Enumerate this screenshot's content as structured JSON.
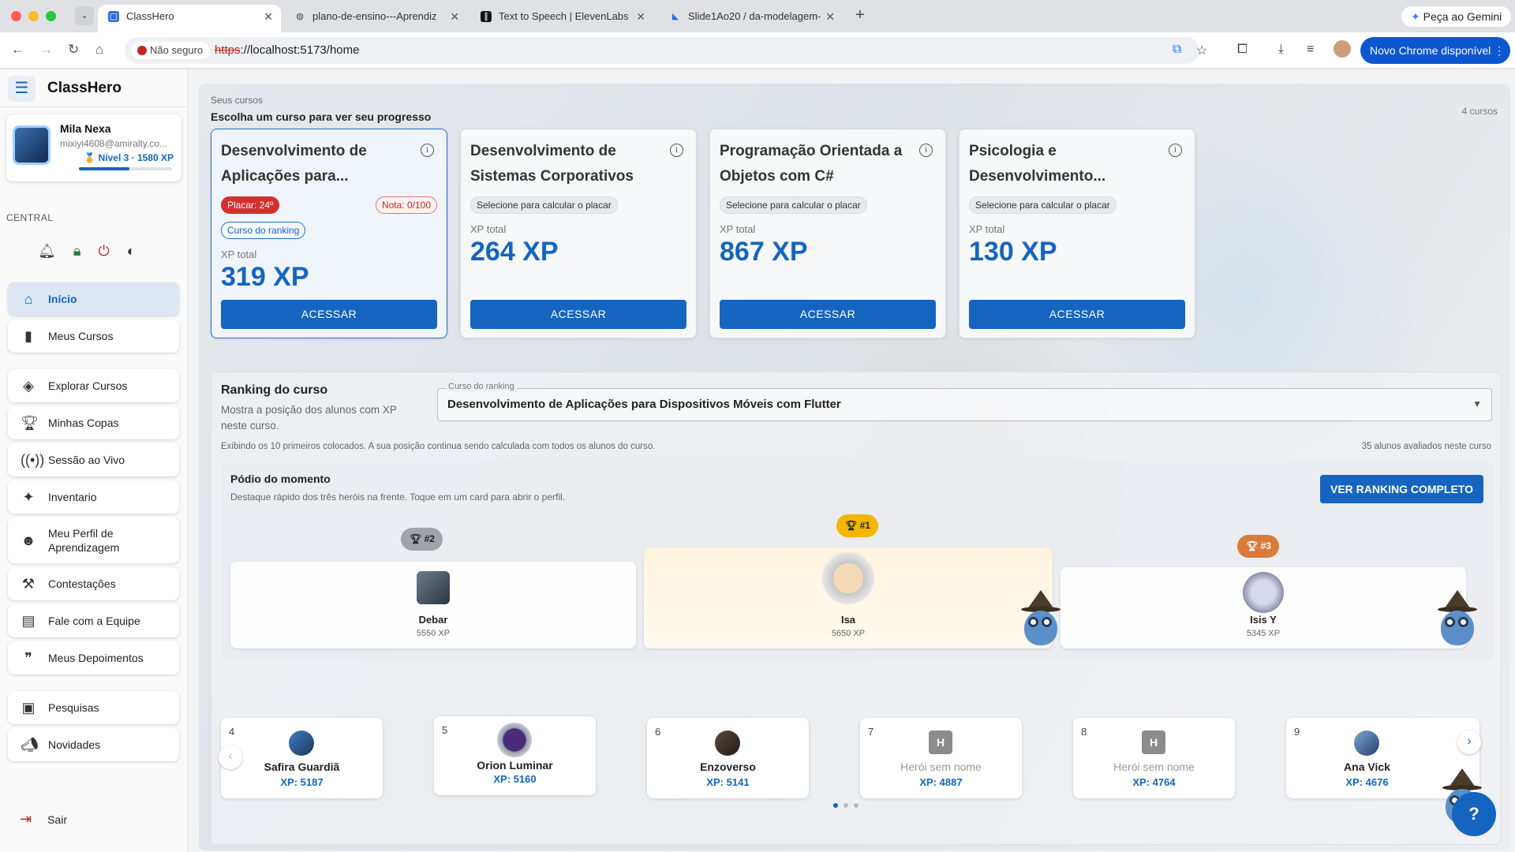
{
  "browser": {
    "tabs": [
      {
        "title": "ClassHero",
        "icon": "classhero-icon"
      },
      {
        "title": "plano-de-ensino---Aprendiz",
        "icon": "globe-icon"
      },
      {
        "title": "Text to Speech | ElevenLabs",
        "icon": "elevenlabs-icon"
      },
      {
        "title": "Slide1Ao20 / da-modelagem-",
        "icon": "bookmark-icon"
      }
    ],
    "gemini_label": "Peça ao Gemini",
    "insecure_label": "Não seguro",
    "url_scheme": "https",
    "url_rest": "://localhost:5173/home",
    "update_label": "Novo Chrome disponível"
  },
  "app": {
    "brand": "ClassHero",
    "user": {
      "name": "Mila Nexa",
      "email": "mixiyi4608@amiralty.co...",
      "level": "Nível 3 · 1580 XP",
      "level_progress": 0.54
    },
    "section_label": "CENTRAL",
    "menu": [
      {
        "label": "Início",
        "icon": "home-icon",
        "active": true
      },
      {
        "label": "Meus Cursos",
        "icon": "book-icon"
      },
      {
        "label": "Explorar Cursos",
        "icon": "school-icon"
      },
      {
        "label": "Minhas Copas",
        "icon": "trophy-icon"
      },
      {
        "label": "Sessão ao Vivo",
        "icon": "broadcast-icon"
      },
      {
        "label": "Inventario",
        "icon": "sparkle-icon"
      },
      {
        "label": "Meu Perfil de Aprendizagem",
        "icon": "psychology-icon"
      },
      {
        "label": "Contestações",
        "icon": "gavel-icon"
      },
      {
        "label": "Fale com a Equipe",
        "icon": "chat-icon"
      },
      {
        "label": "Meus Depoimentos",
        "icon": "quote-icon"
      },
      {
        "label": "Pesquisas",
        "icon": "clipboard-icon"
      },
      {
        "label": "Novidades",
        "icon": "megaphone-icon"
      }
    ],
    "logout": "Sair"
  },
  "courses": {
    "small_label": "Seus cursos",
    "title": "Escolha um curso para ver seu progresso",
    "count": "4 cursos",
    "xp_label": "XP total",
    "access_label": "ACESSAR",
    "select_hint": "Selecione para calcular o placar",
    "items": [
      {
        "title": "Desenvolvimento de Aplicações para...",
        "placar": "Placar: 24º",
        "nota": "Nota: 0/100",
        "ranking_chip": "Curso do ranking",
        "xp": "319 XP"
      },
      {
        "title": "Desenvolvimento de Sistemas Corporativos",
        "xp": "264 XP"
      },
      {
        "title": "Programação Orientada a Objetos com C#",
        "xp": "867 XP"
      },
      {
        "title": "Psicologia e Desenvolvimento...",
        "xp": "130 XP"
      }
    ]
  },
  "ranking": {
    "title": "Ranking do curso",
    "desc": "Mostra a posição dos alunos com XP neste curso.",
    "select_label": "Curso do ranking",
    "select_value": "Desenvolvimento de Aplicações para Dispositivos Móveis com Flutter",
    "note": "Exibindo os 10 primeiros colocados. A sua posição continua sendo calculada com todos os alunos do curso.",
    "evaluated": "35 alunos avaliados neste curso",
    "podium": {
      "title": "Pódio do momento",
      "desc": "Destaque rápido dos três heróis na frente. Toque em um card para abrir o perfil.",
      "button": "VER RANKING COMPLETO",
      "first": {
        "badge": "#1",
        "name": "Isa",
        "xp": "5650 XP"
      },
      "second": {
        "badge": "#2",
        "name": "Debar",
        "xp": "5550 XP"
      },
      "third": {
        "badge": "#3",
        "name": "Isis Y",
        "xp": "5345 XP"
      }
    },
    "others": [
      {
        "pos": "4",
        "name": "Safira Guardiã",
        "xp": "XP: 5187"
      },
      {
        "pos": "5",
        "name": "Orion Luminar",
        "xp": "XP: 5160"
      },
      {
        "pos": "6",
        "name": "Enzoverso",
        "xp": "XP: 5141"
      },
      {
        "pos": "7",
        "name": "Herói sem nome",
        "xp": "XP: 4887",
        "initial": "H"
      },
      {
        "pos": "8",
        "name": "Herói sem nome",
        "xp": "XP: 4764",
        "initial": "H"
      },
      {
        "pos": "9",
        "name": "Ana Vick",
        "xp": "XP: 4676"
      }
    ]
  }
}
